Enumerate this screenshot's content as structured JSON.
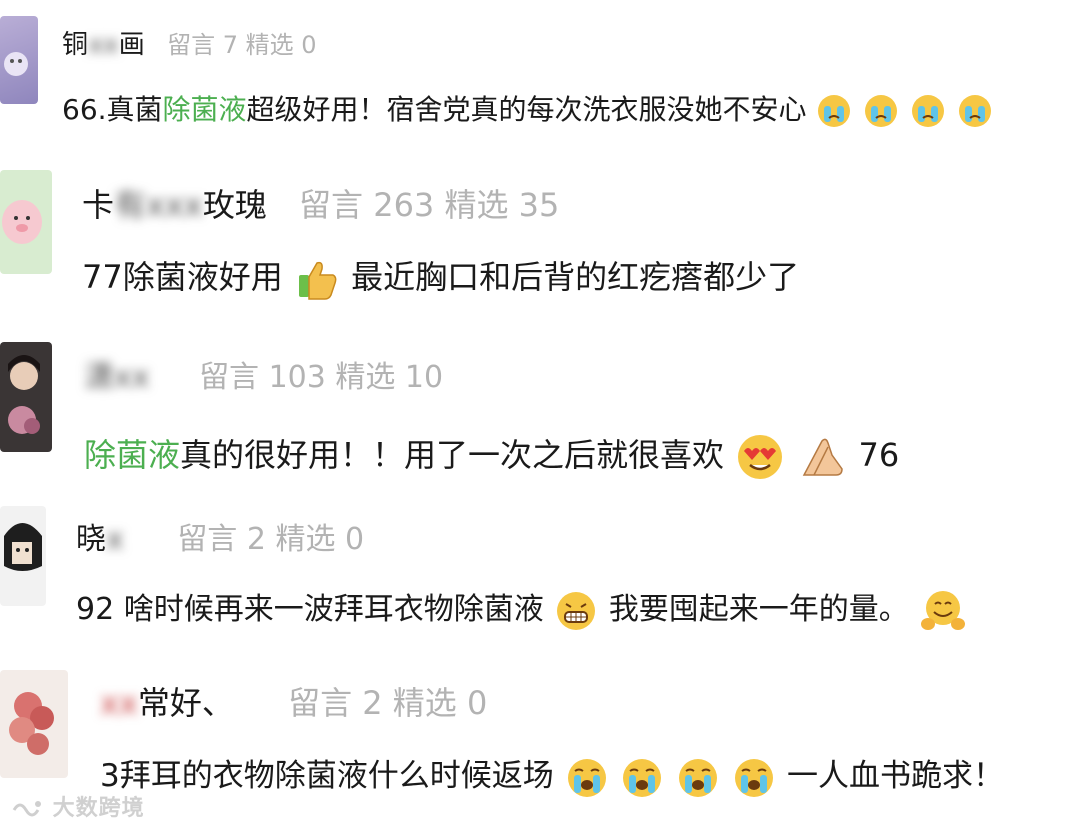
{
  "comments": [
    {
      "name_left": "铜",
      "name_blur": "xx",
      "name_right": "画",
      "meta": "留言 7 精选 0",
      "text_parts": [
        "66.真菌",
        "除菌液",
        "超级好用！宿舍党真的每次洗衣服没她不安心"
      ],
      "emojis": [
        "crying-icon",
        "crying-icon",
        "crying-icon",
        "crying-icon"
      ]
    },
    {
      "name_left": "卡",
      "name_blur": "有xxx",
      "name_right": "玫瑰",
      "meta": "留言 263  精选 35",
      "text_before": "77除菌液好用",
      "text_after": "最近胸口和后背的红疙瘩都少了"
    },
    {
      "name_left": "",
      "name_blur": "潇xx",
      "name_right": "",
      "meta": "留言 103 精选 10",
      "text_highlight": "除菌液",
      "text_mid": "真的很好用！！用了一次之后就很喜欢",
      "text_end": "76"
    },
    {
      "name_left": "晓",
      "name_blur": "x",
      "name_right": "",
      "meta": "留言 2  精选 0",
      "text_before": "92 啥时候再来一波拜耳衣物除菌液",
      "text_after": "我要囤起来一年的量。"
    },
    {
      "name_left": "",
      "name_blur": "xx",
      "name_right": "常好、",
      "meta": "留言 2  精选 0",
      "text_before": "3拜耳的衣物除菌液什么时候返场",
      "text_after": "一人血书跪求！"
    }
  ],
  "watermark": "大数跨境"
}
